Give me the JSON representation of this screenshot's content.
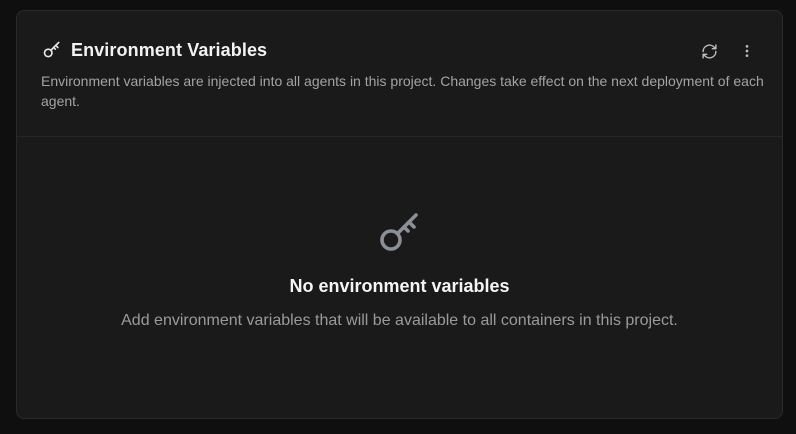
{
  "panel": {
    "title": "Environment Variables",
    "title_icon": "key-icon",
    "description": "Environment variables are injected into all agents in this project. Changes take effect on the next deployment of each agent.",
    "actions": [
      {
        "icon": "refresh-icon"
      },
      {
        "icon": "more-vertical-icon"
      }
    ]
  },
  "empty_state": {
    "icon": "key-icon",
    "title": "No environment variables",
    "description": "Add environment variables that will be available to all containers in this project."
  },
  "colors": {
    "background": "#0f0f0f",
    "card": "#1a1a1a",
    "border": "#2a2a2a",
    "text_primary": "#f2f2f2",
    "text_secondary": "#a3a3a3",
    "icon_muted": "#8a8f98"
  }
}
